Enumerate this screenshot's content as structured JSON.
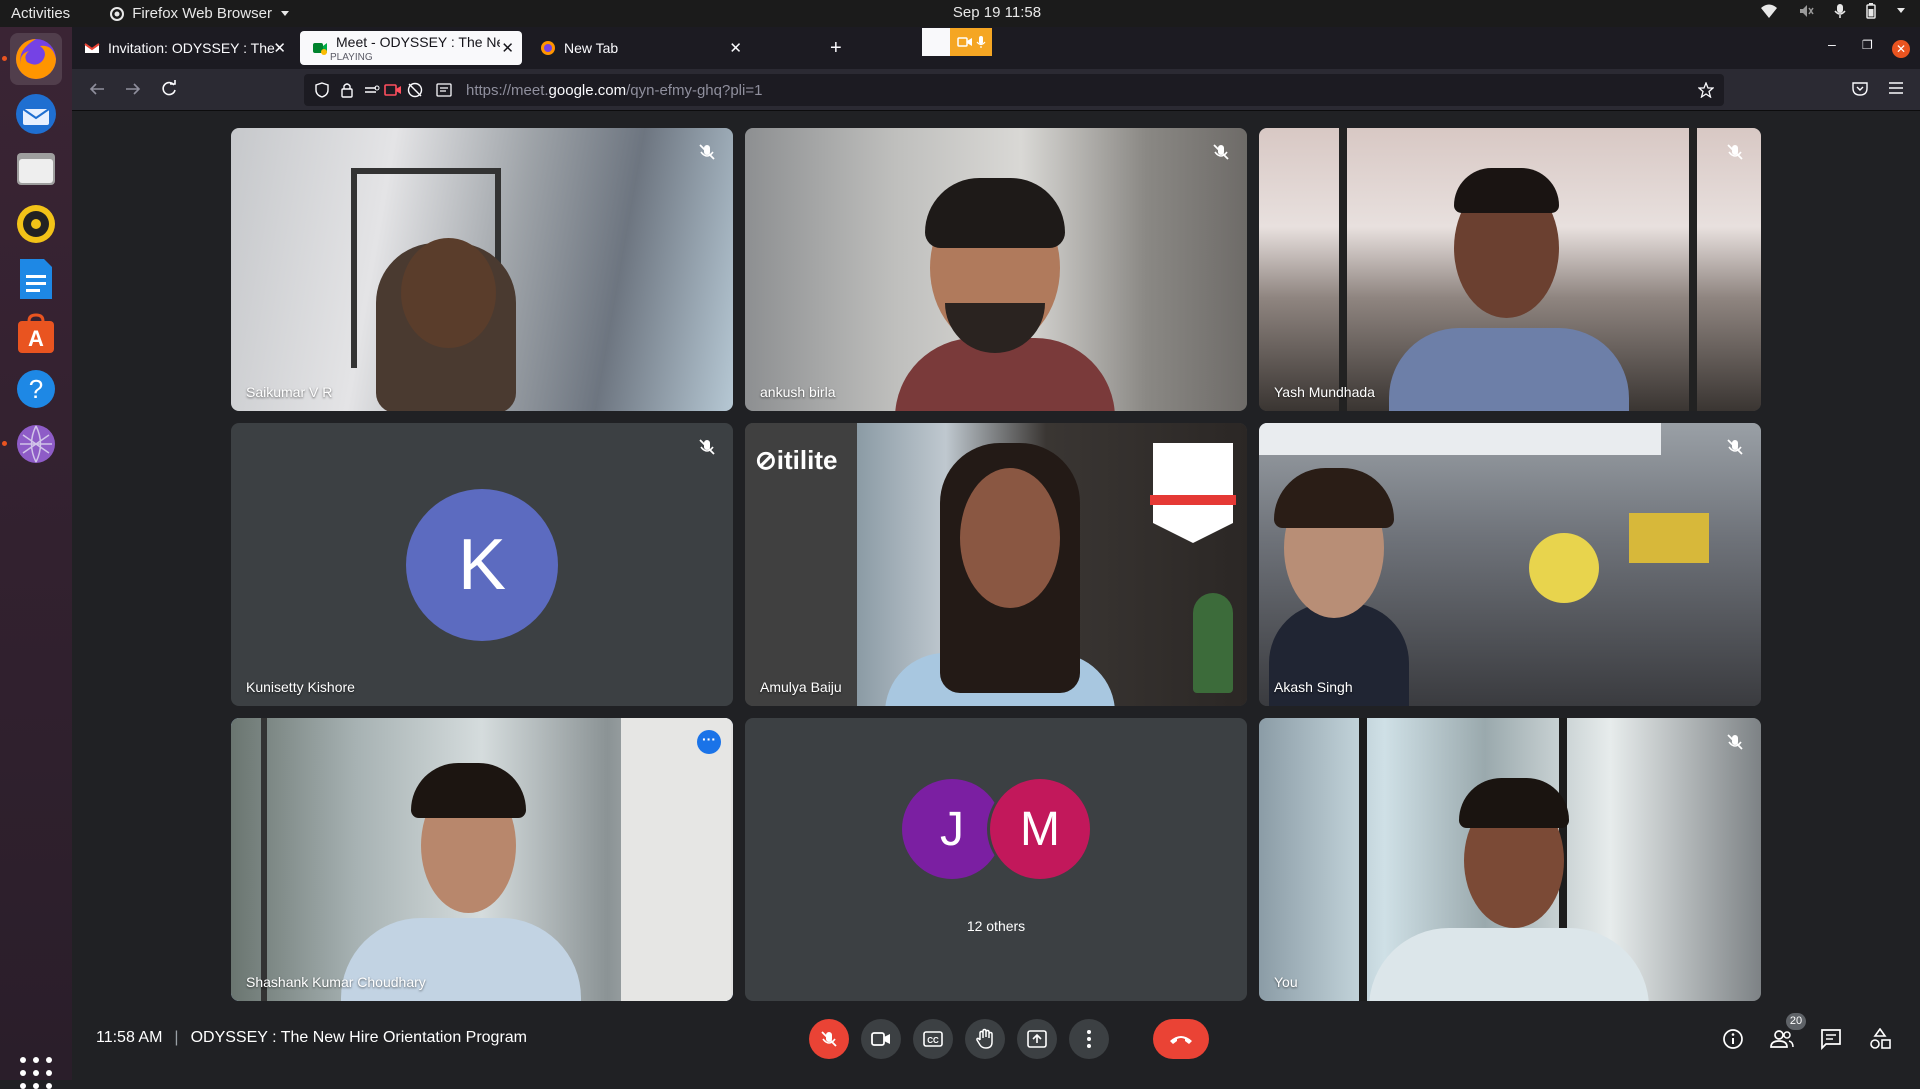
{
  "system": {
    "activities_label": "Activities",
    "app_menu_label": "Firefox Web Browser",
    "clock": "Sep 19  11:58"
  },
  "browser": {
    "tabs": [
      {
        "title": "Invitation: ODYSSEY : The New Hire",
        "favicon": "gmail-icon"
      },
      {
        "title": "Meet - ODYSSEY : The New Hire",
        "subtitle": "PLAYING",
        "favicon": "meet-icon"
      },
      {
        "title": "New Tab",
        "favicon": "firefox-icon"
      }
    ],
    "url_prefix": "https://meet.",
    "url_domain": "google.com",
    "url_path": "/qyn-efmy-ghq?pli=1"
  },
  "meet": {
    "participants": [
      {
        "name": "Saikumar V R",
        "muted": true
      },
      {
        "name": "ankush birla",
        "muted": true
      },
      {
        "name": "Yash Mundhada",
        "muted": true
      },
      {
        "name": "Kunisetty Kishore",
        "muted": true,
        "avatar_letter": "K",
        "avatar_color": "#5c6bc0"
      },
      {
        "name": "Amulya Baiju",
        "muted": false
      },
      {
        "name": "Akash Singh",
        "muted": true
      },
      {
        "name": "Shashank Kumar Choudhary",
        "muted": false,
        "speaking": true
      },
      {
        "name": "You",
        "muted": true
      }
    ],
    "others": {
      "label": "12 others",
      "avatars": [
        {
          "letter": "J",
          "color": "#7b1fa2"
        },
        {
          "letter": "M",
          "color": "#c2185b"
        }
      ]
    },
    "time": "11:58 AM",
    "separator": "|",
    "meeting_title": "ODYSSEY : The New Hire Orientation Program",
    "people_count": "20",
    "accent_color": "#8ab4f8",
    "hangup_color": "#ea4335"
  }
}
